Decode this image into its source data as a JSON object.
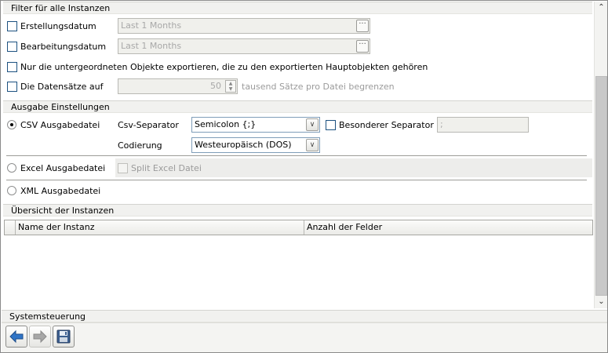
{
  "filter": {
    "header": "Filter für alle Instanzen",
    "creation_date_label": "Erstellungsdatum",
    "creation_date_value": "Last 1 Months",
    "edit_date_label": "Bearbeitungsdatum",
    "edit_date_value": "Last 1 Months",
    "sub_objects_label": "Nur die untergeordneten Objekte exportieren, die zu den exportierten Hauptobjekten gehören",
    "limit_label": "Die Datensätze auf",
    "limit_value": "50",
    "limit_suffix": "tausend Sätze pro Datei begrenzen"
  },
  "output": {
    "header": "Ausgabe Einstellungen",
    "csv_label": "CSV Ausgabedatei",
    "csv_separator_label": "Csv-Separator",
    "csv_separator_value": "Semicolon {;}",
    "special_separator_label": "Besonderer Separator",
    "special_separator_value": ";",
    "encoding_label": "Codierung",
    "encoding_value": "Westeuropäisch (DOS)",
    "excel_label": "Excel Ausgabedatei",
    "split_excel_label": "Split Excel Datei",
    "xml_label": "XML Ausgabedatei",
    "selected_format": "CSV"
  },
  "overview": {
    "header": "Übersicht der Instanzen",
    "columns": [
      "Name der Instanz",
      "Anzahl der Felder"
    ]
  },
  "system": {
    "header": "Systemsteuerung"
  },
  "icons": {
    "back": "arrow-left-icon",
    "forward": "arrow-right-icon",
    "save": "floppy-disk-icon",
    "ellipsis": "ellipsis-icon",
    "dropdown": "chevron-down-icon"
  },
  "colors": {
    "section_bg": "#f1f1ef",
    "checkbox_border": "#1c5180",
    "back_arrow": "#2f74c6"
  }
}
